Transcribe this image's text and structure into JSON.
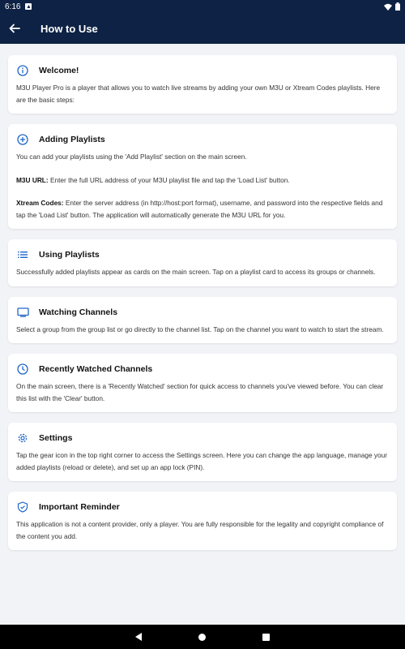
{
  "status_bar": {
    "time": "6:16"
  },
  "app_bar": {
    "title": "How to Use"
  },
  "cards": {
    "welcome": {
      "title": "Welcome!",
      "text": "M3U Player Pro is a player that allows you to watch live streams by adding your own M3U or Xtream Codes playlists. Here are the basic steps:"
    },
    "adding": {
      "title": "Adding Playlists",
      "text": "You can add your playlists using the 'Add Playlist' section on the main screen.",
      "m3u_label": "M3U URL:",
      "m3u_text": " Enter the full URL address of your M3U playlist file and tap the 'Load List' button.",
      "xtream_label": "Xtream Codes:",
      "xtream_text": " Enter the server address (in http://host:port format), username, and password into the respective fields and tap the 'Load List' button. The application will automatically generate the M3U URL for you."
    },
    "using": {
      "title": "Using Playlists",
      "text": "Successfully added playlists appear as cards on the main screen. Tap on a playlist card to access its groups or channels."
    },
    "watching": {
      "title": "Watching Channels",
      "text": "Select a group from the group list or go directly to the channel list. Tap on the channel you want to watch to start the stream."
    },
    "recent": {
      "title": "Recently Watched Channels",
      "text": "On the main screen, there is a 'Recently Watched' section for quick access to channels you've viewed before. You can clear this list with the 'Clear' button."
    },
    "settings": {
      "title": "Settings",
      "text": "Tap the gear icon in the top right corner to access the Settings screen. Here you can change the app language, manage your added playlists (reload or delete), and set up an app lock (PIN)."
    },
    "reminder": {
      "title": "Important Reminder",
      "text": "This application is not a content provider, only a player. You are fully responsible for the legality and copyright compliance of the content you add."
    }
  },
  "colors": {
    "header": "#0d2244",
    "accent": "#1e66c9",
    "background": "#f2f3f7"
  }
}
